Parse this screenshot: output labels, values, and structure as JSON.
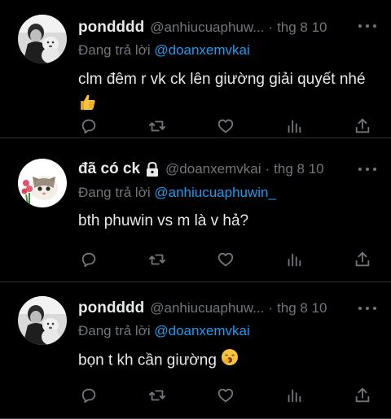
{
  "tweets": [
    {
      "name": "pondddd",
      "locked": false,
      "handle": "@anhiucuaphuw...",
      "time": "thg 8 10",
      "reply_prefix": "Đang trả lời ",
      "reply_to": "@doanxemvkai",
      "text": "clm đêm r vk ck lên giường giải quyết nhé",
      "emoji": "thumbs-up-icon"
    },
    {
      "name": "đã có ck",
      "locked": true,
      "handle": "@doanxemvkai",
      "time": "thg 8 10",
      "reply_prefix": "Đang trả lời ",
      "reply_to": "@anhiucuaphuwin_",
      "text": "bth phuwin vs m là v hả?",
      "emoji": ""
    },
    {
      "name": "pondddd",
      "locked": false,
      "handle": "@anhiucuaphuw...",
      "time": "thg 8 10",
      "reply_prefix": "Đang trả lời ",
      "reply_to": "@doanxemvkai",
      "text": "bọn t kh cần giường",
      "emoji": "yawning-face-icon"
    }
  ],
  "separator": "·",
  "colors": {
    "background": "#000000",
    "text": "#e7e9ea",
    "muted": "#71767b",
    "mention": "#1d9bf0",
    "divider": "#2f3336"
  }
}
